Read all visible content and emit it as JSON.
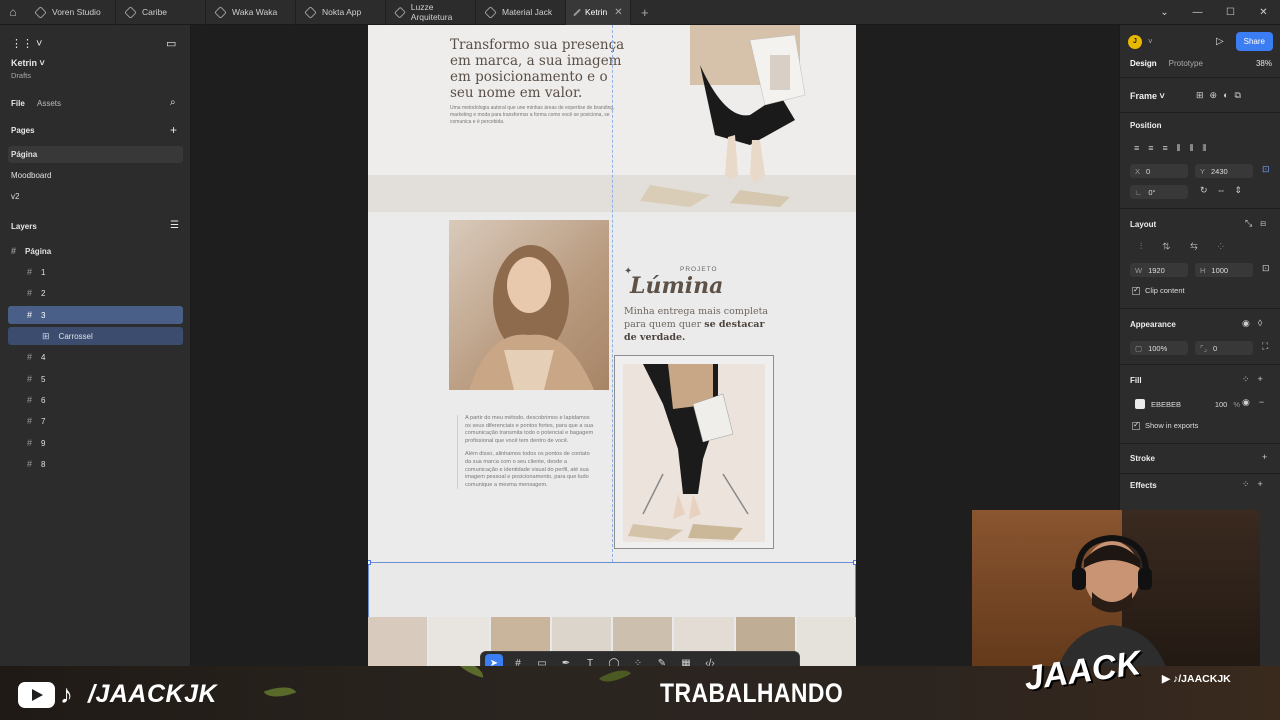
{
  "tabs": [
    {
      "label": "Voren Studio",
      "active": false
    },
    {
      "label": "Caribe",
      "active": false
    },
    {
      "label": "Waka Waka",
      "active": false
    },
    {
      "label": "Nokta App",
      "active": false
    },
    {
      "label": "Luzze Arquitetura",
      "active": false
    },
    {
      "label": "Material Jack",
      "active": false
    },
    {
      "label": "Ketrin",
      "active": true
    }
  ],
  "left": {
    "project_name": "Ketrin",
    "project_location": "Drafts",
    "tab_file": "File",
    "tab_assets": "Assets",
    "pages_title": "Pages",
    "pages": [
      "Página",
      "Moodboard",
      "v2"
    ],
    "layers_title": "Layers",
    "layers_root": "Página",
    "layers": [
      "1",
      "2",
      "3",
      "Carrossel",
      "4",
      "5",
      "6",
      "7",
      "9",
      "8"
    ]
  },
  "canvas": {
    "hero_title": "Transformo sua presença em marca, a sua imagem em posicionamento e o seu nome em valor.",
    "hero_sub": "Uma metodologia autoral que une minhas áreas de expertise de branding, marketing e moda para transformar a forma como você se posiciona, se comunica e é percebida.",
    "projeto": "PROJETO",
    "lumina": "Lúmina",
    "lumina_sub1": "Minha entrega mais completa para quem quer",
    "lumina_sub2": "se destacar de verdade.",
    "body_p1": "A partir do meu método, descobrimos e lapidamos os seus diferenciais e pontos fortes, para que a sua comunicação transmita todo o potencial e bagagem profissional que você tem dentro de você.",
    "body_p2": "Além disso, alinhamos todos os pontos de contato da sua marca com o seu cliente, desde a comunicação e identidade visual do perfil, até sua imagem pessoal e posicionamento, para que tudo comunique a mesma mensagem."
  },
  "right": {
    "avatar_initial": "J",
    "share": "Share",
    "tab_design": "Design",
    "tab_prototype": "Prototype",
    "zoom": "38%",
    "frame_label": "Frame",
    "position_title": "Position",
    "x_label": "X",
    "x": "0",
    "y_label": "Y",
    "y": "2430",
    "rotation": "0°",
    "layout_title": "Layout",
    "w_label": "W",
    "w": "1920",
    "h_label": "H",
    "h": "1000",
    "clip": "Clip content",
    "appearance_title": "Appearance",
    "opacity": "100%",
    "radius": "0",
    "fill_title": "Fill",
    "fill_hex": "EBEBEB",
    "fill_opacity": "100",
    "fill_pct": "%",
    "show_exports": "Show in exports",
    "stroke_title": "Stroke",
    "effects_title": "Effects"
  },
  "overlay": {
    "handle": "/JAACKJK",
    "status": "TRABALHANDO",
    "logo": "JAACK",
    "small_handle": "/JAACKJK"
  },
  "colors": {
    "accent": "#3b7df3",
    "fill": "#ebebeb",
    "selection": "#4a5f88"
  }
}
